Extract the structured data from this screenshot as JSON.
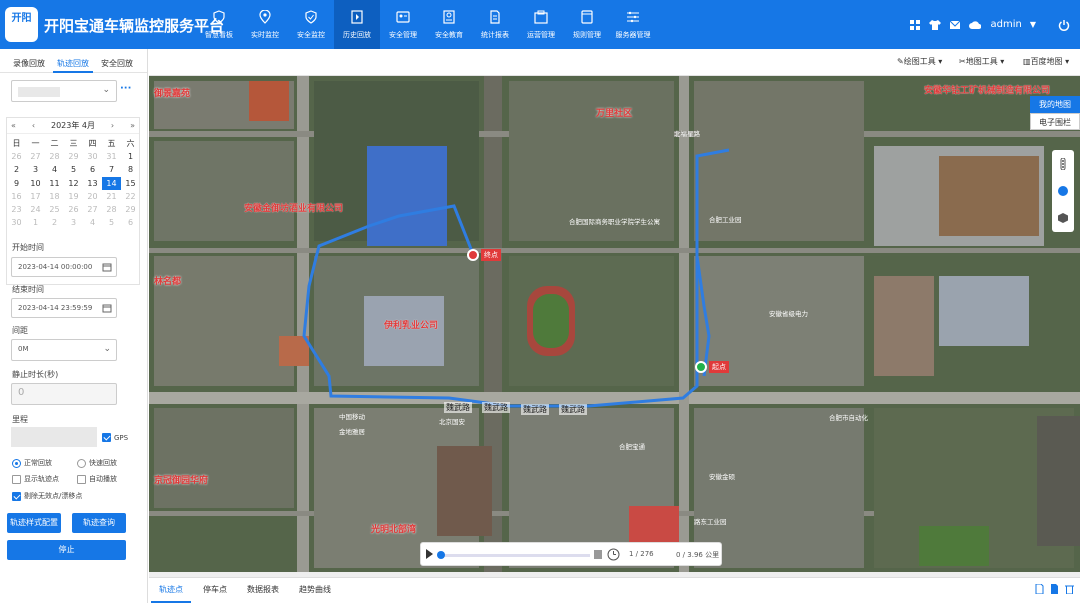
{
  "app": {
    "logo_text": "开阳",
    "title": "开阳宝通车辆监控服务平台"
  },
  "nav": [
    {
      "label": "智慧看板",
      "icon": "shield-icon"
    },
    {
      "label": "实时监控",
      "icon": "location-pin-icon"
    },
    {
      "label": "安全监控",
      "icon": "shield-check-icon"
    },
    {
      "label": "历史回放",
      "icon": "playback-icon"
    },
    {
      "label": "安全管理",
      "icon": "id-card-icon"
    },
    {
      "label": "安全教育",
      "icon": "education-icon"
    },
    {
      "label": "统计报表",
      "icon": "report-icon"
    },
    {
      "label": "运营管理",
      "icon": "operation-icon"
    },
    {
      "label": "规则管理",
      "icon": "rules-icon"
    },
    {
      "label": "服务器管理",
      "icon": "server-icon"
    }
  ],
  "nav_active": "历史回放",
  "header_right": {
    "user": "admin"
  },
  "left": {
    "tabs": [
      "录像回放",
      "轨迹回放",
      "安全回放"
    ],
    "active_tab": "轨迹回放",
    "calendar": {
      "year_month": "2023年 4月",
      "weekdays": [
        "日",
        "一",
        "二",
        "三",
        "四",
        "五",
        "六"
      ],
      "rows": [
        [
          "26",
          "27",
          "28",
          "29",
          "30",
          "31",
          "1"
        ],
        [
          "2",
          "3",
          "4",
          "5",
          "6",
          "7",
          "8"
        ],
        [
          "9",
          "10",
          "11",
          "12",
          "13",
          "14",
          "15"
        ],
        [
          "16",
          "17",
          "18",
          "19",
          "20",
          "21",
          "22"
        ],
        [
          "23",
          "24",
          "25",
          "26",
          "27",
          "28",
          "29"
        ],
        [
          "30",
          "1",
          "2",
          "3",
          "4",
          "5",
          "6"
        ]
      ],
      "selected": "14"
    },
    "start_label": "开始时间",
    "start_value": "2023-04-14 00:00:00",
    "end_label": "结束时间",
    "end_value": "2023-04-14 23:59:59",
    "interval_label": "间距",
    "interval_value": "0M",
    "stop_label": "静止时长(秒)",
    "stop_value": "0",
    "mileage_label": "里程",
    "gps_label": "GPS",
    "opt_normal": "正常回放",
    "opt_fast": "快速回放",
    "opt_show_points": "显示轨迹点",
    "opt_auto": "自动播放",
    "opt_filter": "剔除无效点/漂移点",
    "btn_style": "轨迹样式配置",
    "btn_query": "轨迹查询",
    "btn_stop": "停止"
  },
  "map_toolbar": {
    "draw": "绘图工具",
    "map_tools": "地图工具",
    "baidu": "百度地图"
  },
  "map_types": {
    "mine": "我的地图",
    "fence": "电子围栏"
  },
  "map": {
    "start_label": "起点",
    "end_label": "终点",
    "districts": [
      "万里社区",
      "京冠御园华府",
      "光明北部湾",
      "林名都",
      "御景嘉苑"
    ],
    "pois": [
      "安徽金御坊酒业有限公司",
      "伊利乳业公司",
      "安徽华钻工矿机械制造有限公司"
    ],
    "roads": [
      "魏武路",
      "魏武路",
      "魏武路",
      "魏武路"
    ],
    "small": [
      "北福星路",
      "合肥国际商务职业学院学生公寓",
      "安徽省级电力",
      "合肥工业园",
      "中国移动",
      "金地雅居",
      "北京国安",
      "合肥宝通",
      "安徽金硕",
      "合肥市自动化",
      "路东工业园"
    ]
  },
  "playback": {
    "count": "1 / 276",
    "distance": "0 / 3.96 公里",
    "progress": 0.02
  },
  "bottom_tabs": [
    "轨迹点",
    "停车点",
    "数据报表",
    "趋势曲线"
  ],
  "bottom_active": "轨迹点",
  "colors": {
    "primary": "#1677e6",
    "route": "#2f7de1",
    "start": "#22b14c",
    "end": "#e03a3a"
  }
}
